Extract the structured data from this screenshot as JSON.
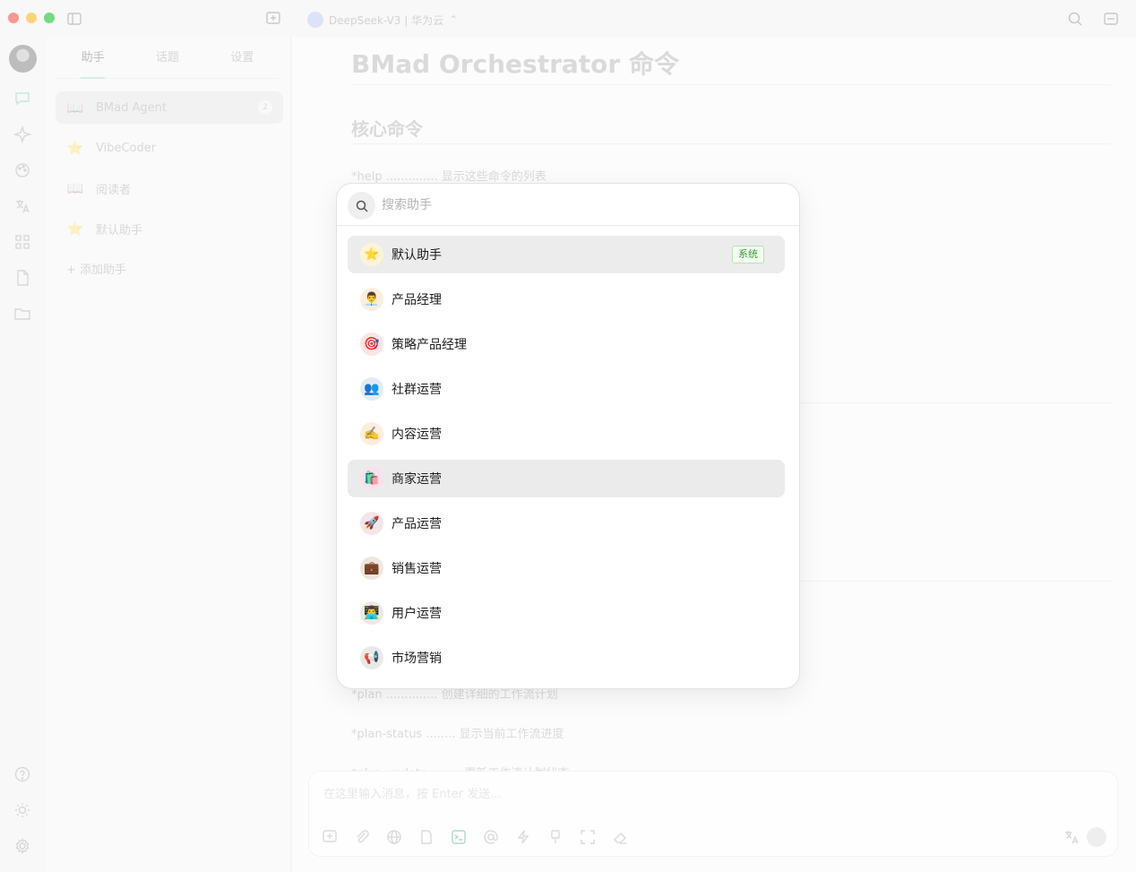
{
  "titlebar": {
    "model_label": "DeepSeek-V3 | 华为云"
  },
  "panel": {
    "tabs": [
      "助手",
      "话题",
      "设置"
    ],
    "assistants": [
      {
        "emoji": "📖",
        "name": "BMad Agent",
        "count": "2"
      },
      {
        "emoji": "⭐",
        "name": "VibeCoder"
      },
      {
        "emoji": "📖",
        "name": "阅读者"
      },
      {
        "emoji": "⭐",
        "name": "默认助手"
      }
    ],
    "add_label": "+ 添加助手"
  },
  "main": {
    "title": "BMad Orchestrator 命令",
    "section": "核心命令",
    "commands": [
      "*help .............. 显示这些命令的列表",
      "*plan .............. 创建详细的工作流计划",
      "*plan-status ........ 显示当前工作流进度",
      "*plan-update ........ 更新工作流计划状态"
    ],
    "composer_placeholder": "在这里输入消息，按 Enter 发送..."
  },
  "popup": {
    "search_placeholder": "搜索助手",
    "items": [
      {
        "emoji": "⭐",
        "label": "默认助手",
        "badge": "系统"
      },
      {
        "emoji": "👨‍💼",
        "label": "产品经理"
      },
      {
        "emoji": "🎯",
        "label": "策略产品经理"
      },
      {
        "emoji": "👥",
        "label": "社群运营"
      },
      {
        "emoji": "✍️",
        "label": "内容运营"
      },
      {
        "emoji": "🛍️",
        "label": "商家运营"
      },
      {
        "emoji": "🚀",
        "label": "产品运营"
      },
      {
        "emoji": "💼",
        "label": "销售运营"
      },
      {
        "emoji": "👨‍💻",
        "label": "用户运营"
      },
      {
        "emoji": "📢",
        "label": "市场营销"
      }
    ]
  },
  "colors": {
    "accent": "#3a9a34",
    "tab_underline": "#bfe5d4"
  }
}
